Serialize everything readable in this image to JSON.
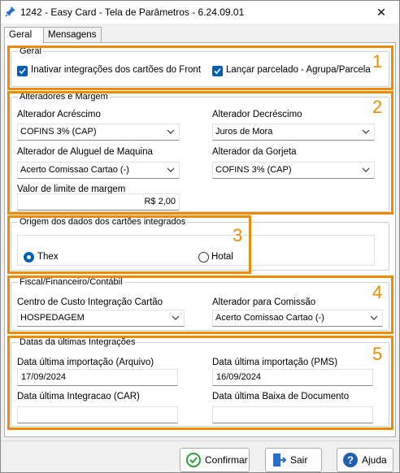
{
  "window": {
    "title": "1242 - Easy Card - Tela de Parâmetros - 6.24.09.01",
    "close_glyph": "✕"
  },
  "tabs": [
    {
      "label": "Geral"
    },
    {
      "label": "Mensagens"
    }
  ],
  "geral": {
    "title": "Geral",
    "check1": {
      "label": "Inativar integrações dos cartões do Front",
      "checked": true
    },
    "check2": {
      "label": "Lançar parcelado - Agrupa/Parcela",
      "checked": true
    }
  },
  "alteradores": {
    "title": "Alteradores e Margem",
    "acrescimo": {
      "label": "Alterador Acréscimo",
      "value": "COFINS 3% (CAP)"
    },
    "decrescimo": {
      "label": "Alterador Decréscimo",
      "value": "Juros de Mora"
    },
    "aluguel": {
      "label": "Alterador de Aluguel de Maquina",
      "value": "Acerto Comissao Cartao (-)"
    },
    "gorjeta": {
      "label": "Alterador da Gorjeta",
      "value": "COFINS 3% (CAP)"
    },
    "limite": {
      "label": "Valor de limite de margem",
      "value": "R$ 2,00"
    }
  },
  "origem": {
    "title": "Origem dos dados dos cartões integrados",
    "thex": {
      "label": "Thex",
      "selected": true
    },
    "hotal": {
      "label": "Hotal",
      "selected": false
    }
  },
  "fiscal": {
    "title": "Fiscal/Financeiro/Contábil",
    "centro": {
      "label": "Centro de Custo Integração Cartão",
      "value": "HOSPEDAGEM"
    },
    "comissao": {
      "label": "Alterador para Comissão",
      "value": "Acerto Comissao Cartao (-)"
    }
  },
  "datas": {
    "title": "Datas da últimas Integrações",
    "arquivo": {
      "label": "Data última importação (Arquivo)",
      "value": "17/09/2024"
    },
    "pms": {
      "label": "Data última importação (PMS)",
      "value": "16/09/2024"
    },
    "car": {
      "label": "Data última Integracao (CAR)",
      "value": ""
    },
    "baixa": {
      "label": "Data última Baixa de Documento",
      "value": ""
    }
  },
  "highlights": [
    "1",
    "2",
    "3",
    "4",
    "5"
  ],
  "buttons": {
    "confirmar": {
      "label": "Confirmar",
      "icon": "check-circle-icon"
    },
    "sair": {
      "label": "Sair",
      "icon": "exit-door-icon"
    },
    "ajuda": {
      "label": "Ajuda",
      "icon": "help-icon"
    }
  },
  "colors": {
    "accent": "#005fb8",
    "highlight": "#f08a00",
    "confirm_green": "#2e9d3a"
  }
}
